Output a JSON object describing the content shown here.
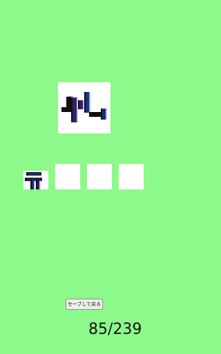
{
  "puzzle": {
    "target_glyph_icon": "fragmented-kanji-glyph-icon",
    "answer_slots": [
      {
        "state": "filled",
        "glyph_icon": "partial-kanji-glyph-icon"
      },
      {
        "state": "empty"
      },
      {
        "state": "empty"
      },
      {
        "state": "empty"
      }
    ]
  },
  "controls": {
    "save_label": "セーブして戻る"
  },
  "progress": {
    "counter": "85/239",
    "current": 85,
    "total": 239
  },
  "colors": {
    "background": "#8cf98a",
    "card": "#ffffff",
    "ink": "#111111"
  }
}
